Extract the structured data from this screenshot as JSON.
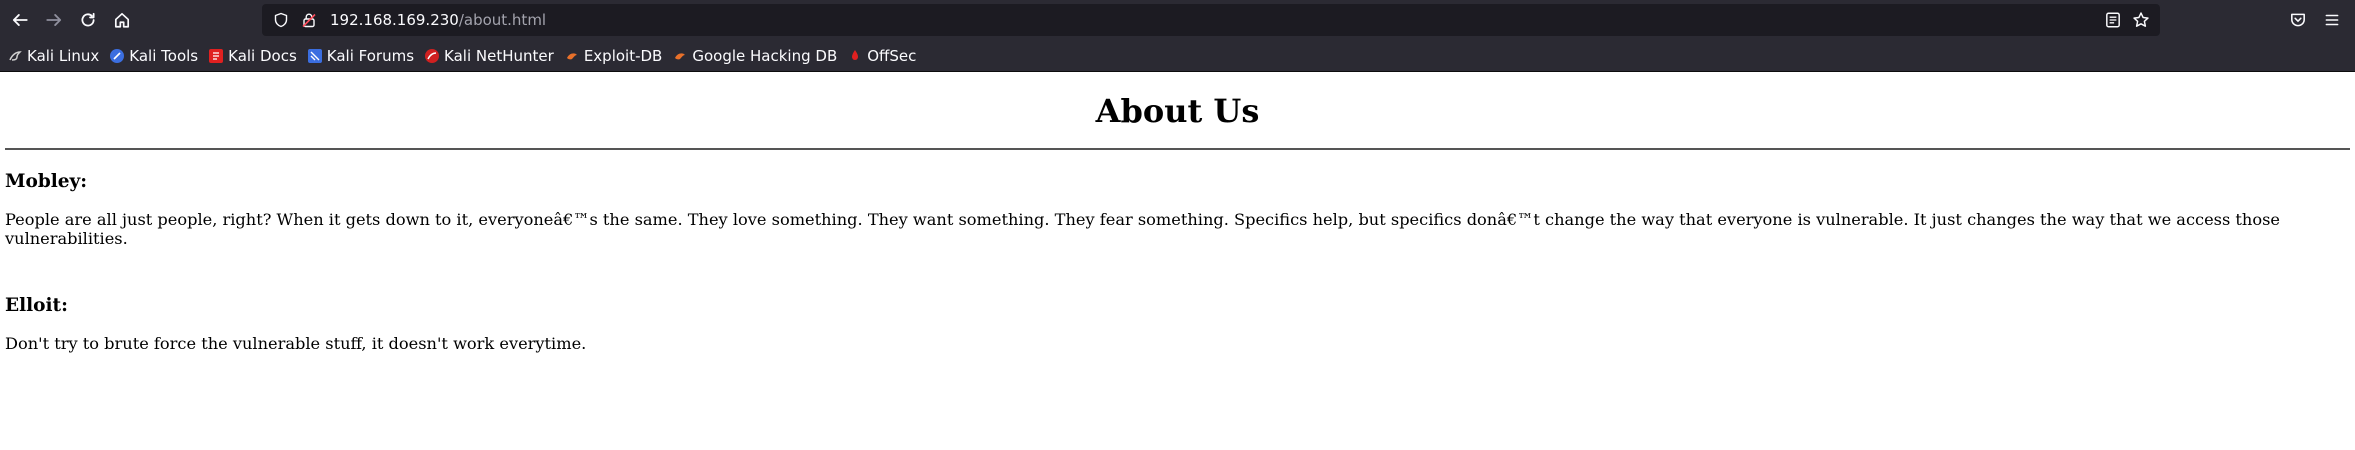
{
  "browser": {
    "url_host": "192.168.169.230",
    "url_path": "/about.html",
    "bookmarks": [
      {
        "label": "Kali Linux",
        "icon": "kali-dragon-icon",
        "color": "#1c1c1c"
      },
      {
        "label": "Kali Tools",
        "icon": "kali-tools-icon",
        "color": "#3b6ee0"
      },
      {
        "label": "Kali Docs",
        "icon": "kali-docs-icon",
        "color": "#e02020"
      },
      {
        "label": "Kali Forums",
        "icon": "kali-forums-icon",
        "color": "#3b6ee0"
      },
      {
        "label": "Kali NetHunter",
        "icon": "nethunter-icon",
        "color": "#d02020"
      },
      {
        "label": "Exploit-DB",
        "icon": "exploit-db-icon",
        "color": "#e8702a"
      },
      {
        "label": "Google Hacking DB",
        "icon": "ghdb-icon",
        "color": "#e8702a"
      },
      {
        "label": "OffSec",
        "icon": "offsec-icon",
        "color": "#e02020"
      }
    ]
  },
  "page": {
    "title": "About Us",
    "sections": [
      {
        "name": "Mobley:",
        "text": "People are all just people, right? When it gets down to it, everyoneâ€™s the same. They love something. They want something. They fear something. Specifics help, but specifics donâ€™t change the way that everyone is vulnerable. It just changes the way that we access those vulnerabilities."
      },
      {
        "name": "Elloit:",
        "text": "Don't try to brute force the vulnerable stuff, it doesn't work everytime."
      }
    ]
  }
}
